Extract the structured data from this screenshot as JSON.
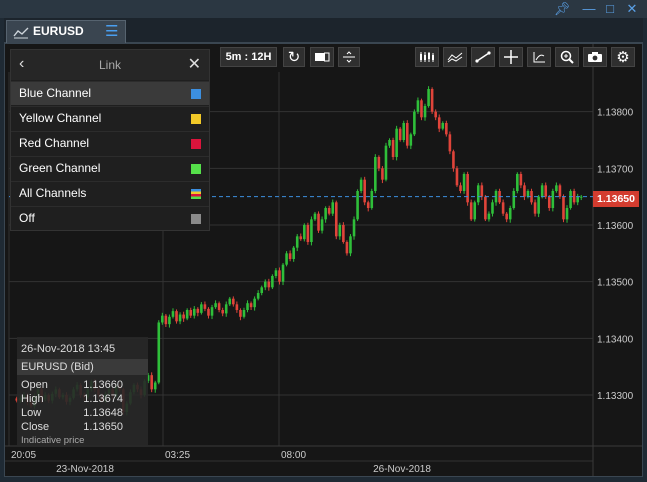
{
  "window": {
    "pin_icon": "pin-icon",
    "controls": [
      "minimize",
      "maximize",
      "close"
    ]
  },
  "tab": {
    "title": "EURUSD",
    "icon": "line-chart-icon",
    "menu_icon": "hamburger-icon"
  },
  "toolbar": {
    "interval": "5m : 12H",
    "icons": [
      "refresh-icon",
      "chart-mode-icon",
      "crosshair-split-icon",
      "candles-icon",
      "indicators-icon",
      "draw-line-icon",
      "crosshair-icon",
      "annotation-icon",
      "zoom-icon",
      "camera-icon",
      "settings-icon"
    ]
  },
  "link_panel": {
    "title": "Link",
    "items": [
      {
        "label": "Blue Channel",
        "color": "#3c8fe0",
        "selected": true
      },
      {
        "label": "Yellow Channel",
        "color": "#f2c928",
        "selected": false
      },
      {
        "label": "Red Channel",
        "color": "#dc143c",
        "selected": false
      },
      {
        "label": "Green Channel",
        "color": "#55e04a",
        "selected": false
      },
      {
        "label": "All Channels",
        "color": "multi",
        "selected": false
      },
      {
        "label": "Off",
        "color": "#8a8a8a",
        "selected": false
      }
    ]
  },
  "info_box": {
    "date": "26-Nov-2018 13:45",
    "symbol": "EURUSD (Bid)",
    "rows": [
      {
        "label": "Open",
        "value": "1.13660"
      },
      {
        "label": "High",
        "value": "1.13674"
      },
      {
        "label": "Low",
        "value": "1.13648"
      },
      {
        "label": "Close",
        "value": "1.13650"
      }
    ],
    "note": "Indicative price"
  },
  "price_axis": {
    "labels": [
      "1.13800",
      "1.13700",
      "1.13600",
      "1.13500",
      "1.13400",
      "1.13300"
    ],
    "current": "1.13650",
    "current_color": "#d33c2f"
  },
  "time_axis": {
    "labels": [
      "20:05",
      "03:25",
      "08:00"
    ],
    "dates": [
      "23-Nov-2018",
      "26-Nov-2018"
    ]
  },
  "colors": {
    "up": "#2fbf3a",
    "down": "#e0443a",
    "grid": "#333333",
    "background": "#161616"
  },
  "chart_data": {
    "type": "candlestick",
    "symbol": "EURUSD",
    "ylim": [
      1.1321,
      1.1387
    ],
    "current_price": 1.1365,
    "x_labels": [
      "20:05",
      "03:25",
      "08:00"
    ],
    "date_labels": [
      "23-Nov-2018",
      "26-Nov-2018"
    ],
    "y_ticks": [
      1.138,
      1.137,
      1.136,
      1.135,
      1.134,
      1.133
    ],
    "closes": [
      1.1329,
      1.13295,
      1.133,
      1.13288,
      1.1328,
      1.13298,
      1.1331,
      1.13292,
      1.133,
      1.1329,
      1.13302,
      1.1331,
      1.13296,
      1.133,
      1.13288,
      1.13295,
      1.1331,
      1.13318,
      1.133,
      1.13296,
      1.1331,
      1.13324,
      1.1331,
      1.133,
      1.1329,
      1.13302,
      1.1331,
      1.13298,
      1.13315,
      1.1331,
      1.1327,
      1.13285,
      1.13305,
      1.13318,
      1.1331,
      1.133,
      1.13325,
      1.13335,
      1.1331,
      1.13322,
      1.13428,
      1.1344,
      1.13425,
      1.13438,
      1.13448,
      1.1343,
      1.13442,
      1.13435,
      1.1345,
      1.1344,
      1.13452,
      1.13445,
      1.1346,
      1.13452,
      1.1344,
      1.13455,
      1.13462,
      1.1345,
      1.13444,
      1.1346,
      1.1347,
      1.1346,
      1.1345,
      1.13438,
      1.1345,
      1.13462,
      1.13455,
      1.1347,
      1.1348,
      1.1349,
      1.135,
      1.1349,
      1.1351,
      1.1352,
      1.135,
      1.1353,
      1.1355,
      1.1354,
      1.1356,
      1.1358,
      1.13575,
      1.136,
      1.1357,
      1.1361,
      1.1362,
      1.1359,
      1.1361,
      1.1363,
      1.1362,
      1.1364,
      1.1358,
      1.136,
      1.1357,
      1.1355,
      1.1358,
      1.1361,
      1.1366,
      1.1368,
      1.1364,
      1.1363,
      1.1366,
      1.1372,
      1.137,
      1.1368,
      1.1374,
      1.1375,
      1.1372,
      1.1377,
      1.1375,
      1.1378,
      1.1374,
      1.1376,
      1.138,
      1.1382,
      1.1379,
      1.1381,
      1.1384,
      1.138,
      1.1379,
      1.1377,
      1.1378,
      1.1376,
      1.1373,
      1.137,
      1.1367,
      1.1366,
      1.1369,
      1.1364,
      1.1361,
      1.1364,
      1.1367,
      1.1365,
      1.1361,
      1.1362,
      1.1364,
      1.1366,
      1.1364,
      1.1362,
      1.1361,
      1.1363,
      1.1366,
      1.1369,
      1.1367,
      1.1365,
      1.1366,
      1.1364,
      1.1362,
      1.1365,
      1.1367,
      1.1365,
      1.1363,
      1.1366,
      1.1367,
      1.1365,
      1.1361,
      1.1363,
      1.1366,
      1.1364,
      1.1365,
      1.1365
    ]
  }
}
